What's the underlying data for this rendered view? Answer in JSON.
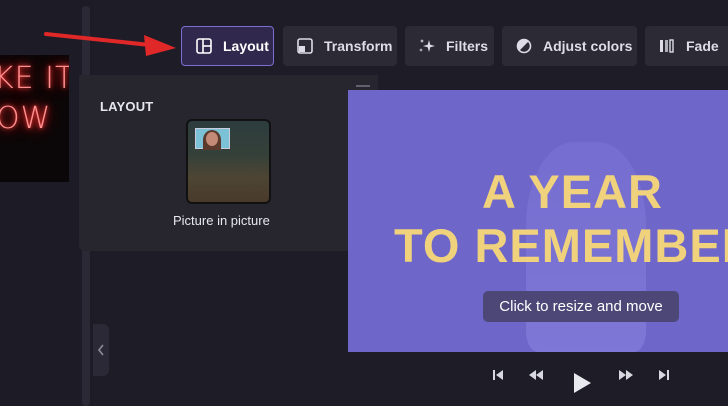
{
  "left_panel": {
    "thumbnail_lines": [
      "KE IT",
      "OW"
    ]
  },
  "toolbar": {
    "buttons": [
      {
        "label": "Layout",
        "icon": "layout-icon",
        "active": true
      },
      {
        "label": "Transform",
        "icon": "transform-icon",
        "active": false
      },
      {
        "label": "Filters",
        "icon": "sparkle-icon",
        "active": false
      },
      {
        "label": "Adjust colors",
        "icon": "adjust-colors-icon",
        "active": false
      },
      {
        "label": "Fade",
        "icon": "fade-icon",
        "active": false
      }
    ]
  },
  "layout_panel": {
    "title": "LAYOUT",
    "options": [
      {
        "label": "Picture in picture",
        "icon": "picture-in-picture-thumbnail"
      }
    ]
  },
  "preview": {
    "headline_line1": "A YEAR",
    "headline_line2": "TO REMEMBER",
    "tooltip": "Click to resize and move"
  },
  "playback": {
    "controls": [
      "skip-to-start-icon",
      "rewind-icon",
      "play-icon",
      "fast-forward-icon",
      "skip-to-end-icon"
    ]
  },
  "colors": {
    "accent": "#7a6fd0",
    "preview_bg": "#6e66c9",
    "headline": "#f1d27c",
    "annotation_arrow": "#e02828"
  }
}
